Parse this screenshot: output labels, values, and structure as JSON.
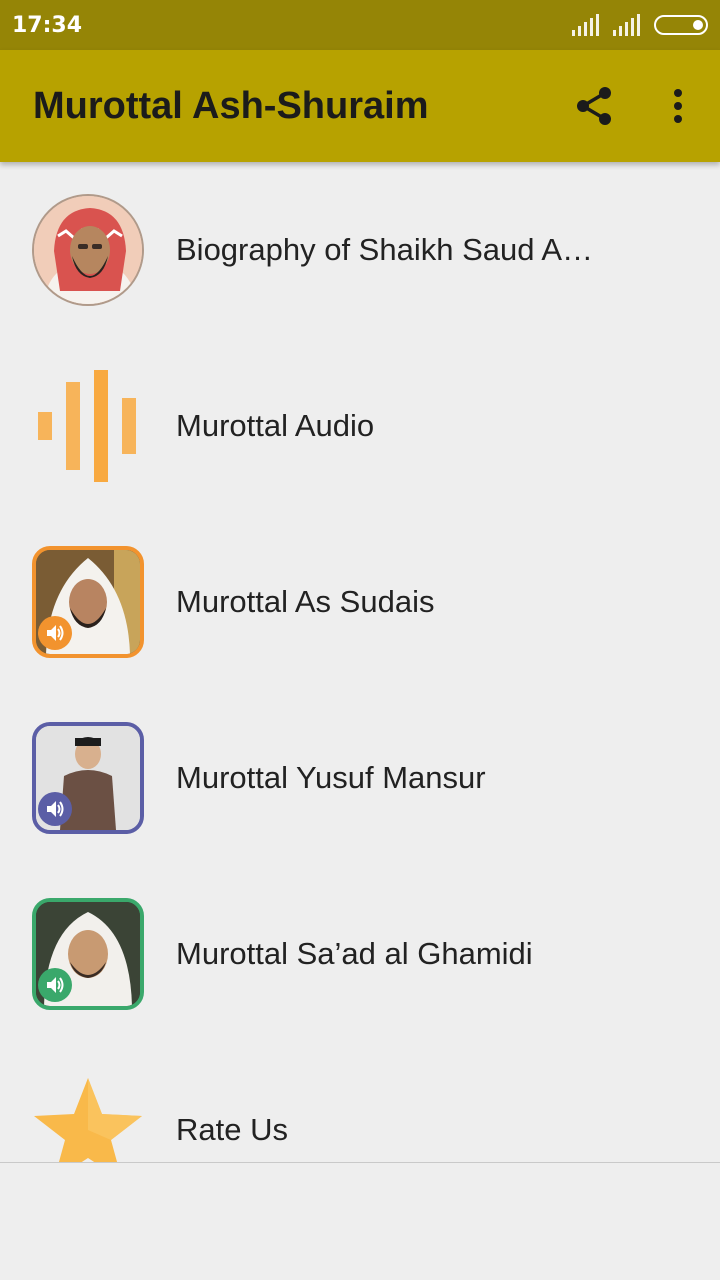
{
  "status_bar": {
    "time": "17:34"
  },
  "app_bar": {
    "title": "Murottal Ash-Shuraim"
  },
  "items": [
    {
      "label": "Biography of Shaikh Saud Al…"
    },
    {
      "label": "Murottal Audio"
    },
    {
      "label": "Murottal As Sudais"
    },
    {
      "label": "Murottal Yusuf Mansur"
    },
    {
      "label": "Murottal Sa’ad al Ghamidi"
    },
    {
      "label": "Rate Us"
    }
  ],
  "colors": {
    "status_bar": "#958506",
    "app_bar": "#b7a200",
    "sudais_frame": "#f2932e",
    "yusuf_frame": "#5b5ea6",
    "ghamidi_frame": "#3aa86b",
    "audio_bars": "#f8a940",
    "star": "#f9b94a"
  }
}
